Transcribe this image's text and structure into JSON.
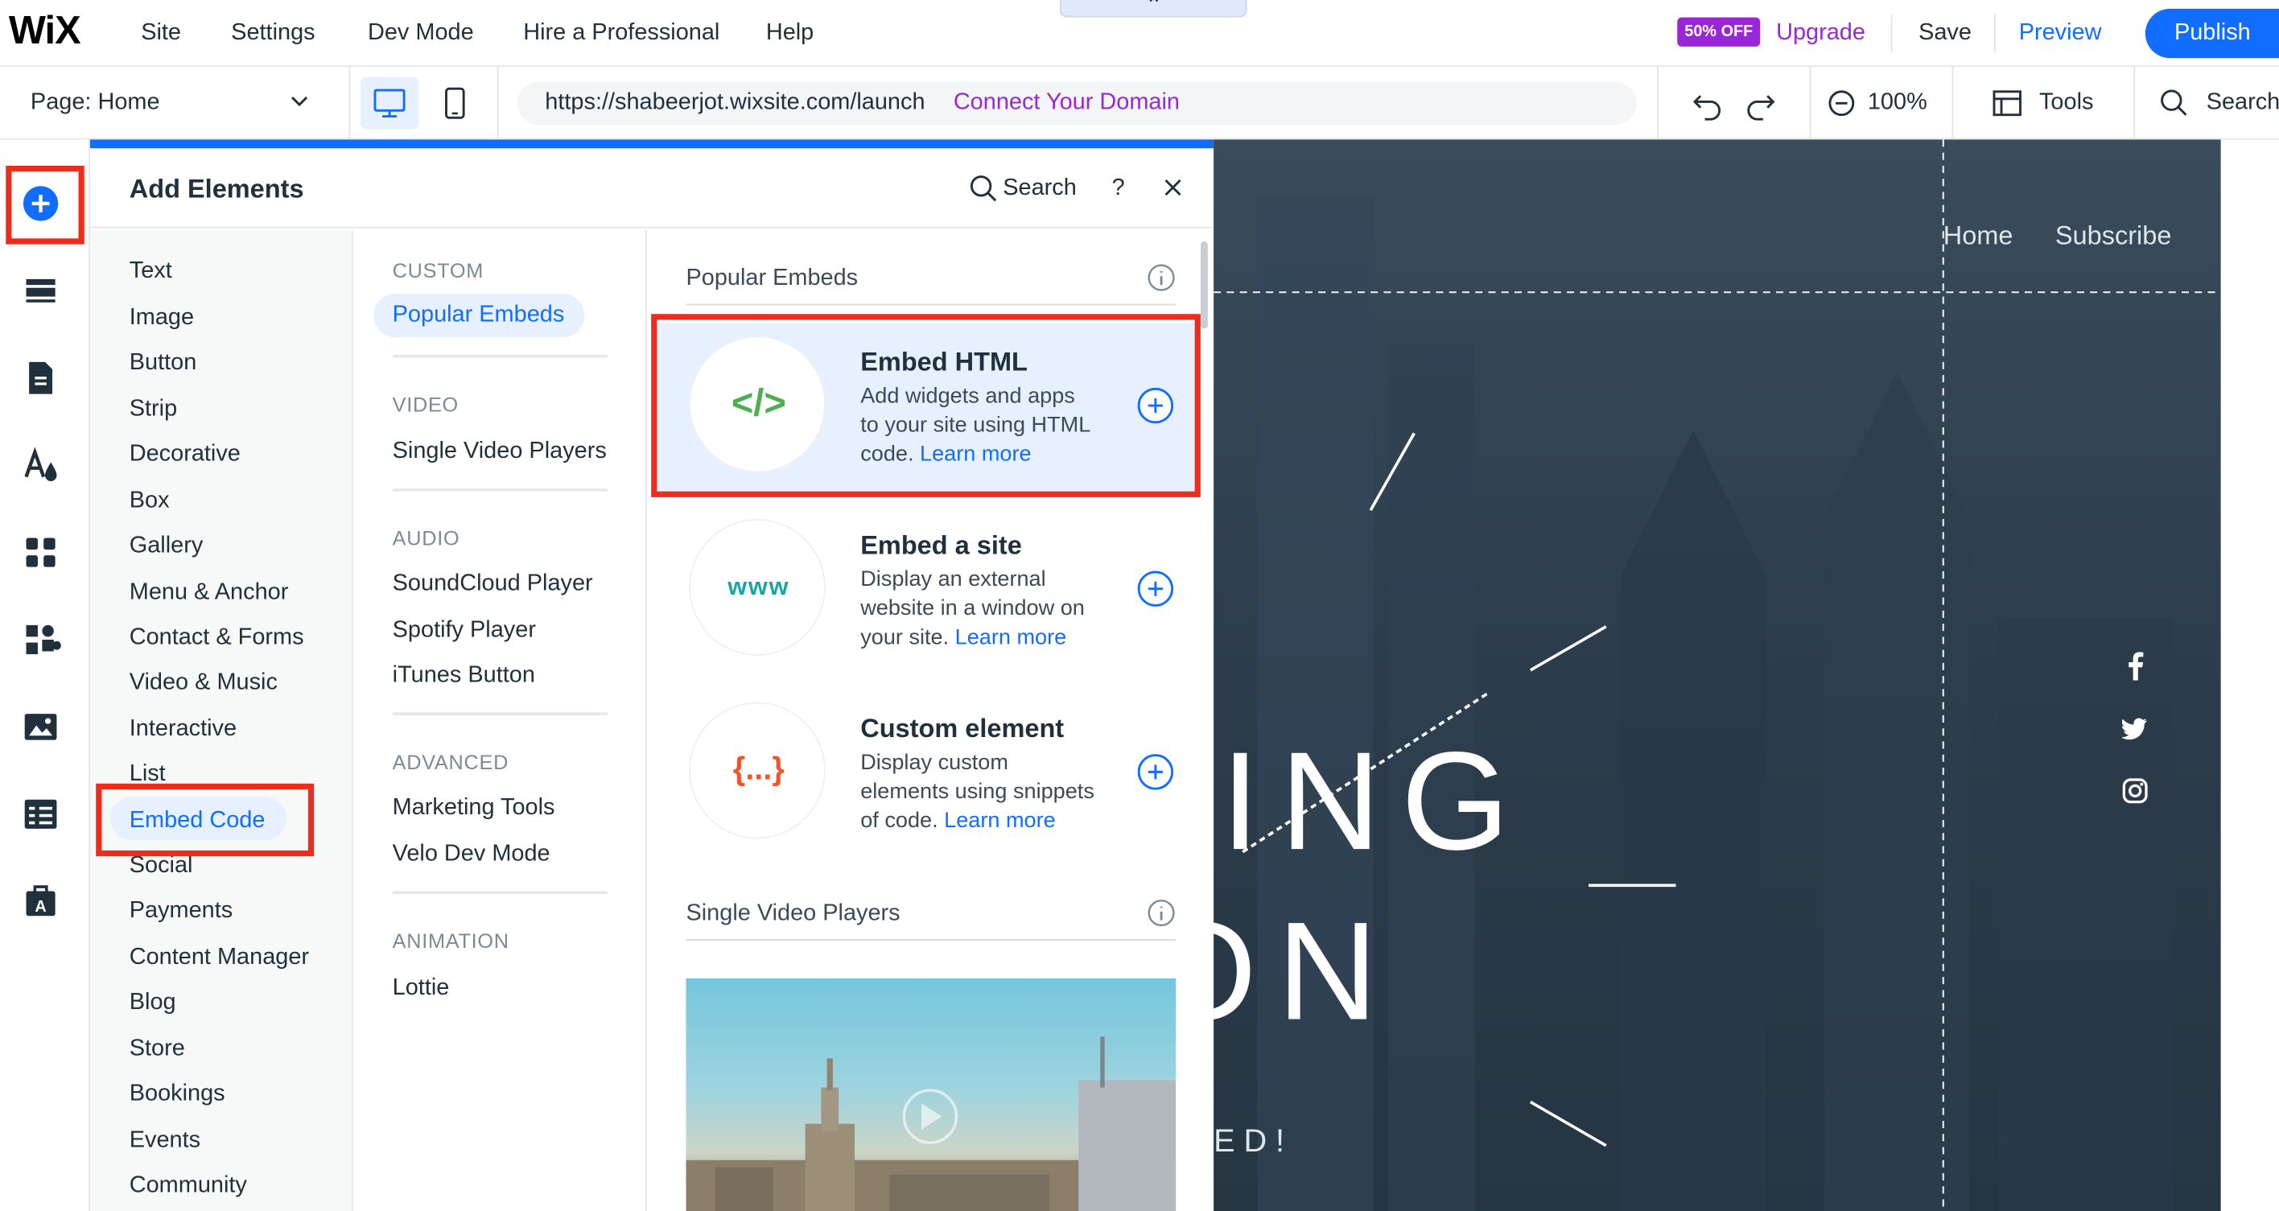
{
  "topbar": {
    "logo": "WiX",
    "nav": [
      "Site",
      "Settings",
      "Dev Mode",
      "Hire a Professional",
      "Help"
    ],
    "promo_badge": "50% OFF",
    "upgrade": "Upgrade",
    "save": "Save",
    "preview": "Preview",
    "publish": "Publish"
  },
  "bar2": {
    "page_selector": "Page: Home",
    "url": "https://shabeerjot.wixsite.com/launch",
    "connect_domain": "Connect Your Domain",
    "zoom": "100%",
    "tools": "Tools",
    "search": "Search"
  },
  "rail": {
    "icons": [
      "add-icon",
      "sections-icon",
      "pages-icon",
      "design-icon",
      "apps-icon",
      "add-apps-icon",
      "media-icon",
      "cms-icon",
      "business-icon"
    ]
  },
  "panel": {
    "title": "Add Elements",
    "search": "Search",
    "help": "?",
    "categories": [
      "Text",
      "Image",
      "Button",
      "Strip",
      "Decorative",
      "Box",
      "Gallery",
      "Menu & Anchor",
      "Contact & Forms",
      "Video & Music",
      "Interactive",
      "List",
      "Embed Code",
      "Social",
      "Payments",
      "Content Manager",
      "Blog",
      "Store",
      "Bookings",
      "Events",
      "Community"
    ],
    "active_category": "Embed Code",
    "subsections": [
      {
        "header": "CUSTOM",
        "items": [
          "Popular Embeds"
        ]
      },
      {
        "header": "VIDEO",
        "items": [
          "Single Video Players"
        ]
      },
      {
        "header": "AUDIO",
        "items": [
          "SoundCloud Player",
          "Spotify Player",
          "iTunes Button"
        ]
      },
      {
        "header": "ADVANCED",
        "items": [
          "Marketing Tools",
          "Velo Dev Mode"
        ]
      },
      {
        "header": "ANIMATION",
        "items": [
          "Lottie"
        ]
      }
    ],
    "content": {
      "section1": "Popular Embeds",
      "cards": [
        {
          "icon": "</>",
          "title": "Embed HTML",
          "desc_lines": [
            "Add widgets and apps",
            "to your site using HTML"
          ],
          "desc_last": "code.",
          "learn_more": "Learn more"
        },
        {
          "icon": "www",
          "title": "Embed a site",
          "desc_lines": [
            "Display an external",
            "website in a window on"
          ],
          "desc_last": "your site.",
          "learn_more": "Learn more"
        },
        {
          "icon": "{...}",
          "title": "Custom element",
          "desc_lines": [
            "Display custom",
            "elements using snippets"
          ],
          "desc_last": "of code.",
          "learn_more": "Learn more"
        }
      ],
      "section2": "Single Video Players"
    }
  },
  "site": {
    "nav": [
      "Home",
      "Subscribe"
    ],
    "hero_line1": "ING",
    "hero_line2": "ON",
    "subtext": "ED!"
  },
  "colors": {
    "accent": "#116dff",
    "premium": "#9a27d5",
    "highlight_box": "#ed2c1b"
  }
}
